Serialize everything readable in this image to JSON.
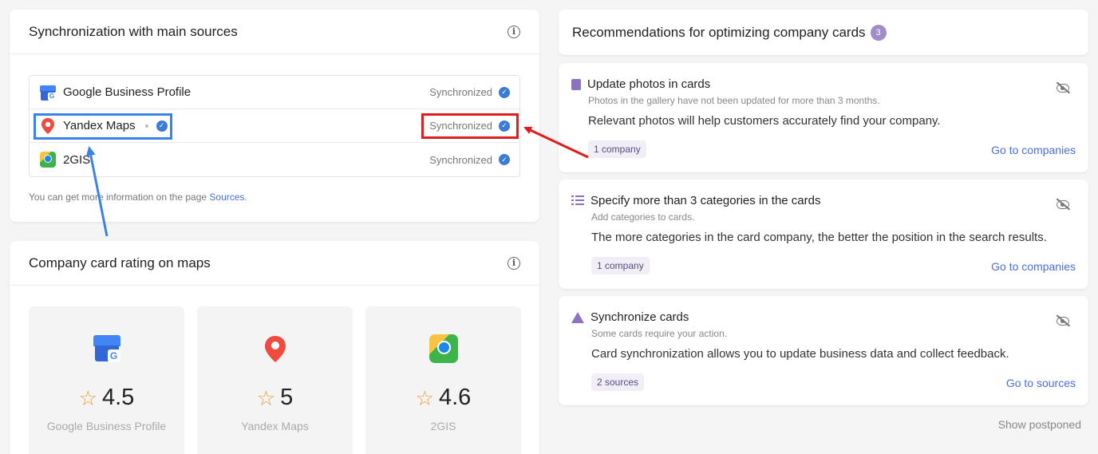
{
  "sync": {
    "title": "Synchronization with main sources",
    "sources": [
      {
        "name": "Google Business Profile",
        "status": "Synchronized",
        "icon": "google-business-icon"
      },
      {
        "name": "Yandex Maps",
        "status": "Synchronized",
        "icon": "yandex-maps-pin-icon"
      },
      {
        "name": "2GIS",
        "status": "Synchronized",
        "icon": "2gis-icon"
      }
    ],
    "note_prefix": "You can get more information on the page ",
    "note_link": "Sources",
    "note_suffix": "."
  },
  "rating": {
    "title": "Company card rating on maps",
    "tiles": [
      {
        "name": "Google Business Profile",
        "value": "4.5"
      },
      {
        "name": "Yandex Maps",
        "value": "5"
      },
      {
        "name": "2GIS",
        "value": "4.6"
      }
    ]
  },
  "recommendations": {
    "title": "Recommendations for optimizing company cards",
    "count": "3",
    "items": [
      {
        "title": "Update photos in cards",
        "subtitle": "Photos in the gallery have not been updated for more than 3 months.",
        "description": "Relevant photos will help customers accurately find your company.",
        "tag": "1 company",
        "link": "Go to companies"
      },
      {
        "title": "Specify more than 3 categories in the cards",
        "subtitle": "Add categories to cards.",
        "description": "The more categories in the card company, the better the position in the search results.",
        "tag": "1 company",
        "link": "Go to companies"
      },
      {
        "title": "Synchronize cards",
        "subtitle": "Some cards require your action.",
        "description": "Card synchronization allows you to update business data and collect feedback.",
        "tag": "2 sources",
        "link": "Go to sources"
      }
    ],
    "show_postponed": "Show postponed"
  },
  "colors": {
    "accent": "#4a6fd6",
    "check": "#3a7bd5",
    "purple": "#8e72c2",
    "highlight_blue": "#3b82e6",
    "highlight_red": "#e01b1b",
    "star": "#f29b38"
  }
}
